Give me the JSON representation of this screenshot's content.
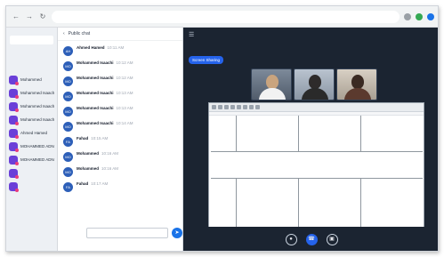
{
  "browser": {
    "url": "",
    "icons": [
      "back-icon",
      "forward-icon",
      "reload-icon",
      "extension-icon",
      "profile-icon"
    ]
  },
  "sidebar": {
    "section_label": "",
    "active_pill": "",
    "items": [
      {
        "name": "Mohammed"
      },
      {
        "name": "Mohammed Isaach"
      },
      {
        "name": "Mohammed Isaach"
      },
      {
        "name": "Mohammed Isaach"
      },
      {
        "name": "Ahmed Hamed"
      },
      {
        "name": "MOHAMMED ADNAN"
      },
      {
        "name": "MOHAMMED ADNAN"
      },
      {
        "name": ""
      },
      {
        "name": ""
      }
    ]
  },
  "chat": {
    "header": "Public chat",
    "messages": [
      {
        "initials": "AH",
        "name": "Ahmed Hamed",
        "time": "10:11 AM",
        "text": ""
      },
      {
        "initials": "MO",
        "name": "Mohammed Isaachi",
        "time": "10:12 AM",
        "text": ""
      },
      {
        "initials": "MO",
        "name": "Mohammed Isaachi",
        "time": "10:12 AM",
        "text": ""
      },
      {
        "initials": "MO",
        "name": "Mohammed Isaachi",
        "time": "10:13 AM",
        "text": ""
      },
      {
        "initials": "MO",
        "name": "Mohammed Isaachi",
        "time": "10:13 AM",
        "text": ""
      },
      {
        "initials": "MO",
        "name": "Mohammed Isaachi",
        "time": "10:14 AM",
        "text": ""
      },
      {
        "initials": "FA",
        "name": "Fahad",
        "time": "10:15 AM",
        "text": ""
      },
      {
        "initials": "MO",
        "name": "Mohammed",
        "time": "10:16 AM",
        "text": ""
      },
      {
        "initials": "MO",
        "name": "Mohammed",
        "time": "10:16 AM",
        "text": ""
      },
      {
        "initials": "FA",
        "name": "Fahad",
        "time": "10:17 AM",
        "text": ""
      }
    ],
    "input_placeholder": "",
    "send_icon": "send-icon"
  },
  "meeting": {
    "title": "",
    "timer": "",
    "share_label": "Screen Sharing",
    "participants": [
      {
        "name": ""
      },
      {
        "name": ""
      },
      {
        "name": ""
      }
    ],
    "document": {
      "cells": [
        "",
        "",
        "",
        ""
      ]
    },
    "controls": [
      "microphone-icon",
      "phone-icon",
      "camera-icon"
    ]
  }
}
